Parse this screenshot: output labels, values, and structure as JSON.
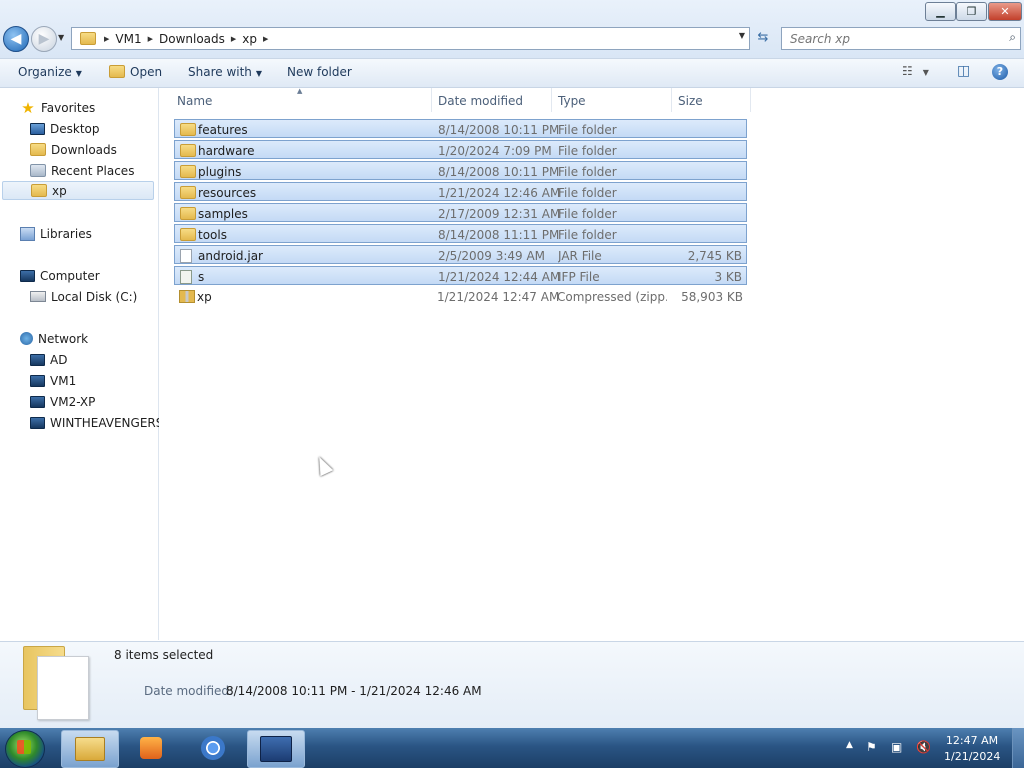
{
  "window": {
    "minimize_label": "▁",
    "restore_label": "❐",
    "close_label": "✕"
  },
  "address": {
    "breadcrumbs": [
      "VM1",
      "Downloads",
      "xp"
    ],
    "search_placeholder": "Search xp"
  },
  "toolbar": {
    "organize": "Organize",
    "open": "Open",
    "share_with": "Share with",
    "new_folder": "New folder"
  },
  "nav": {
    "favorites": "Favorites",
    "favorites_items": [
      "Desktop",
      "Downloads",
      "Recent Places",
      "xp"
    ],
    "libraries": "Libraries",
    "computer": "Computer",
    "computer_items": [
      "Local Disk (C:)"
    ],
    "network": "Network",
    "network_items": [
      "AD",
      "VM1",
      "VM2-XP",
      "WINTHEAVENGERS"
    ]
  },
  "columns": {
    "name": "Name",
    "date_modified": "Date modified",
    "type": "Type",
    "size": "Size"
  },
  "files": [
    {
      "name": "features",
      "date": "8/14/2008 10:11 PM",
      "type": "File folder",
      "size": "",
      "icon": "folder-icon",
      "selected": true
    },
    {
      "name": "hardware",
      "date": "1/20/2024 7:09 PM",
      "type": "File folder",
      "size": "",
      "icon": "folder-icon",
      "selected": true
    },
    {
      "name": "plugins",
      "date": "8/14/2008 10:11 PM",
      "type": "File folder",
      "size": "",
      "icon": "folder-icon",
      "selected": true
    },
    {
      "name": "resources",
      "date": "1/21/2024 12:46 AM",
      "type": "File folder",
      "size": "",
      "icon": "folder-icon",
      "selected": true
    },
    {
      "name": "samples",
      "date": "2/17/2009 12:31 AM",
      "type": "File folder",
      "size": "",
      "icon": "folder-icon",
      "selected": true
    },
    {
      "name": "tools",
      "date": "8/14/2008 11:11 PM",
      "type": "File folder",
      "size": "",
      "icon": "folder-icon",
      "selected": true
    },
    {
      "name": "android.jar",
      "date": "2/5/2009 3:49 AM",
      "type": "JAR File",
      "size": "2,745 KB",
      "icon": "file-icon",
      "selected": true
    },
    {
      "name": "s",
      "date": "1/21/2024 12:44 AM",
      "type": "IFP File",
      "size": "3 KB",
      "icon": "ifp-file-icon",
      "selected": true
    },
    {
      "name": "xp",
      "date": "1/21/2024 12:47 AM",
      "type": "Compressed (zipp...",
      "size": "58,903 KB",
      "icon": "zip-folder-icon",
      "selected": false
    }
  ],
  "details": {
    "count": "8 items selected",
    "date_label": "Date modified:",
    "date_value": "8/14/2008 10:11 PM - 1/21/2024 12:46 AM"
  },
  "taskbar": {
    "time": "12:47 AM",
    "date": "1/21/2024"
  }
}
